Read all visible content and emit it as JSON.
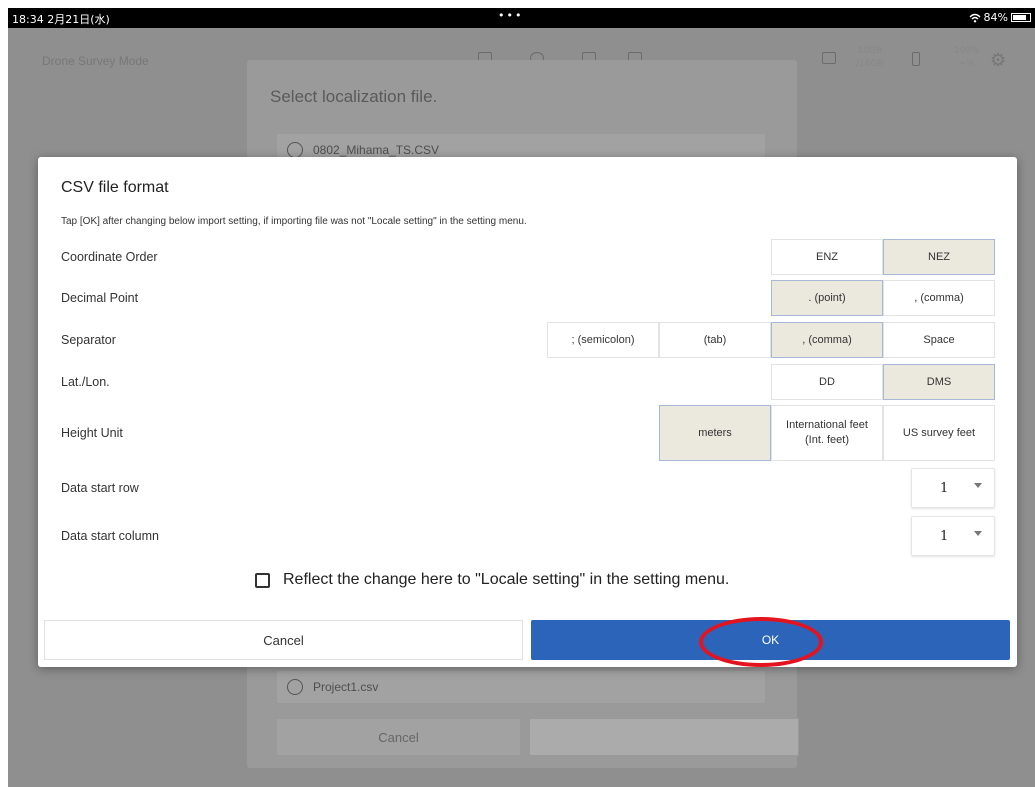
{
  "status_bar": {
    "time": "18:34 2月21日(水)",
    "dots": "•••",
    "wifi_icon": "wifi-icon",
    "battery_text": "84%",
    "battery_level": 0.84
  },
  "app": {
    "title": "Drone Survey Mode",
    "storage_line1": "10GB",
    "storage_line2": "/16GB",
    "battery_line1": "100%",
    "battery_line2": "+%"
  },
  "bg_dialog": {
    "title": "Select localization file.",
    "files": [
      "0802_Mihama_TS.CSV",
      "Project1.csv"
    ],
    "cancel_label": "Cancel"
  },
  "csv_dialog": {
    "title": "CSV file format",
    "instruction": "Tap [OK] after changing below import setting, if importing file was not \"Locale setting\" in the setting menu.",
    "coordinate_order": {
      "label": "Coordinate Order",
      "options": [
        "ENZ",
        "NEZ"
      ],
      "selected": "NEZ"
    },
    "decimal_point": {
      "label": "Decimal Point",
      "options": [
        ". (point)",
        ", (comma)"
      ],
      "selected": ". (point)"
    },
    "separator": {
      "label": "Separator",
      "options": [
        "; (semicolon)",
        "(tab)",
        ", (comma)",
        "Space"
      ],
      "selected": ", (comma)"
    },
    "latlon": {
      "label": "Lat./Lon.",
      "options": [
        "DD",
        "DMS"
      ],
      "selected": "DMS"
    },
    "height_unit": {
      "label": "Height Unit",
      "options": [
        "meters",
        "International feet (Int. feet)",
        "US survey feet"
      ],
      "selected": "meters"
    },
    "data_start_row": {
      "label": "Data start row",
      "value": "1"
    },
    "data_start_column": {
      "label": "Data start column",
      "value": "1"
    },
    "reflect_label": "Reflect the change here to \"Locale setting\" in the setting menu.",
    "reflect_checked": false,
    "cancel_label": "Cancel",
    "ok_label": "OK"
  },
  "colors": {
    "accent": "#2b64b8",
    "selected_option": "#ebe8de",
    "highlight": "#e3141f",
    "dim_overlay": "#8f8f8f"
  }
}
